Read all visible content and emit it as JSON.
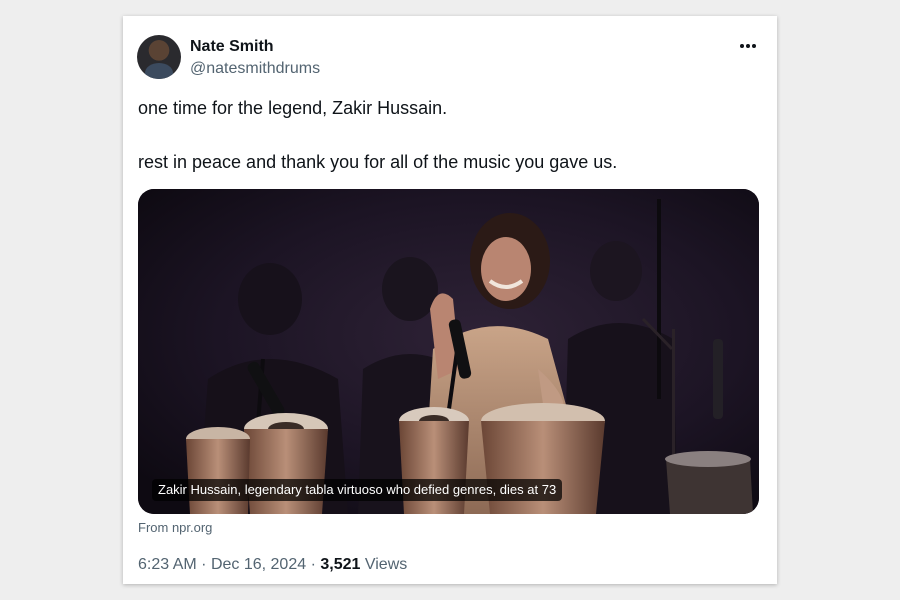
{
  "tweet": {
    "author": {
      "display_name": "Nate Smith",
      "handle": "@natesmithdrums"
    },
    "text_lines": [
      "one time for the legend, Zakir Hussain.",
      "rest in peace and thank you for all of the music you gave us."
    ],
    "media": {
      "caption": "Zakir Hussain, legendary tabla virtuoso who defied genres, dies at 73",
      "source": "From npr.org"
    },
    "meta": {
      "time": "6:23 AM",
      "date": "Dec 16, 2024",
      "separator": "·",
      "views_count": "3,521",
      "views_label": "Views"
    },
    "icons": {
      "more": "more-options-icon"
    }
  }
}
